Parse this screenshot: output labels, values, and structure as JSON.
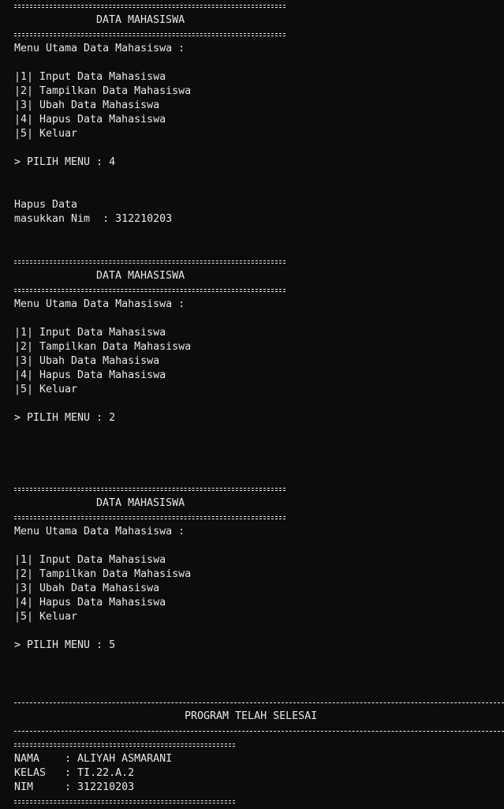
{
  "menu_title": "DATA MAHASISWA",
  "menu_header": "Menu Utama Data Mahasiswa :",
  "menu_items": [
    "|1| Input Data Mahasiswa",
    "|2| Tampilkan Data Mahasiswa",
    "|3| Ubah Data Mahasiswa",
    "|4| Hapus Data Mahasiswa",
    "|5| Keluar"
  ],
  "prompts": [
    "> PILIH MENU : 4",
    "> PILIH MENU : 2",
    "> PILIH MENU : 5"
  ],
  "delete_section": {
    "title": "Hapus Data",
    "nim_prompt": "masukkan Nim  : 312210203"
  },
  "footer": {
    "message": "PROGRAM TELAH SELESAI",
    "nama": "NAMA    : ALIYAH ASMARANI",
    "kelas": "KELAS   : TI.22.A.2",
    "nim": "NIM     : 312210203"
  },
  "colors": {
    "background": "#0c0c0c",
    "text": "#e8e8e8"
  }
}
